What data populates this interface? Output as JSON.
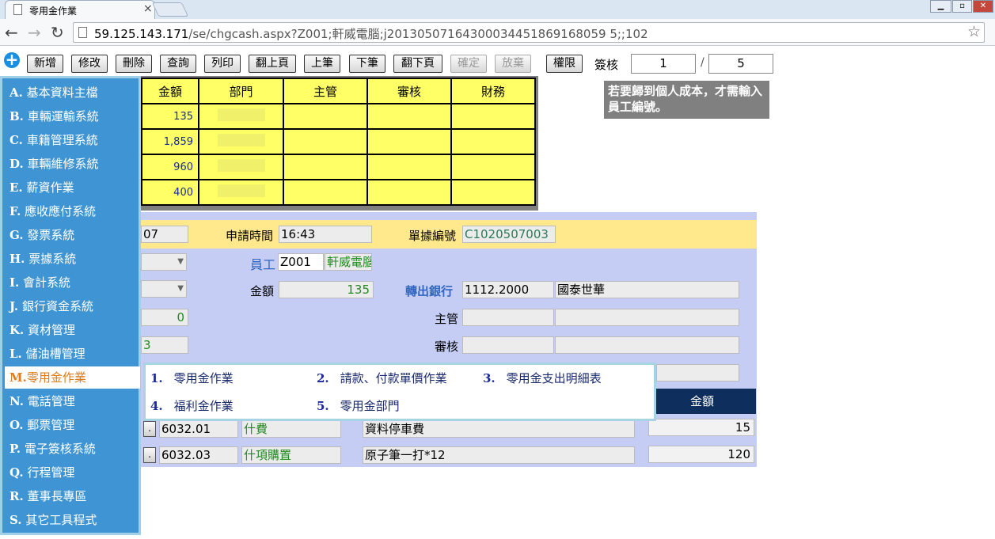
{
  "browser": {
    "tab_title": "零用金作業",
    "url_host": "59.125.143.171",
    "url_path": "/se/chgcash.aspx?Z001;軒威電腦;j20130507164300034451869168059 5;;102"
  },
  "toolbar": {
    "buttons": [
      "新增",
      "修改",
      "刪除",
      "查詢",
      "列印",
      "翻上頁",
      "上筆",
      "下筆",
      "翻下頁",
      "確定",
      "放棄",
      "權限"
    ],
    "sign_label": "簽核",
    "page_current": "1",
    "page_sep": "/",
    "page_total": "5"
  },
  "grid": {
    "headers": [
      "金額",
      "部門",
      "主管",
      "審核",
      "財務"
    ],
    "amounts": [
      "135",
      "1,859",
      "960",
      "400"
    ]
  },
  "tip": "若要歸到個人成本，才需輸入員工編號。",
  "form": {
    "date_tail": "07",
    "apply_time_label": "申請時間",
    "apply_time": "16:43",
    "doc_no_label": "單據編號",
    "doc_no": "C1020507003",
    "employee_label": "員工",
    "employee_id": "Z001",
    "employee_name": "軒威電腦",
    "amount_label": "金額",
    "amount": "135",
    "bank_label": "轉出銀行",
    "bank_code": "1112.2000",
    "bank_name": "國泰世華",
    "left_value": "0",
    "left_value2": "3",
    "manager_label": "主管",
    "review_label": "審核"
  },
  "detail": {
    "amount_header": "金額",
    "rows": [
      {
        "btn": ".",
        "code": "6032.01",
        "cat": "什費",
        "desc": "資料停車費",
        "amount": "15"
      },
      {
        "btn": ".",
        "code": "6032.03",
        "cat": "什項購置",
        "desc": "原子筆一打*12",
        "amount": "120"
      }
    ]
  },
  "menu": [
    {
      "k": "A.",
      "t": "基本資料主檔"
    },
    {
      "k": "B.",
      "t": "車輛運輸系統"
    },
    {
      "k": "C.",
      "t": "車籍管理系統"
    },
    {
      "k": "D.",
      "t": "車輛維修系統"
    },
    {
      "k": "E.",
      "t": "薪資作業"
    },
    {
      "k": "F.",
      "t": "應收應付系統"
    },
    {
      "k": "G.",
      "t": "發票系統"
    },
    {
      "k": "H.",
      "t": "票據系統"
    },
    {
      "k": "I.",
      "t": "會計系統"
    },
    {
      "k": "J.",
      "t": "銀行資金系統"
    },
    {
      "k": "K.",
      "t": "資材管理"
    },
    {
      "k": "L.",
      "t": "儲油槽管理"
    },
    {
      "k": "M.",
      "t": "零用金作業"
    },
    {
      "k": "N.",
      "t": "電話管理"
    },
    {
      "k": "O.",
      "t": "郵票管理"
    },
    {
      "k": "P.",
      "t": "電子簽核系統"
    },
    {
      "k": "Q.",
      "t": "行程管理"
    },
    {
      "k": "R.",
      "t": "董事長專區"
    },
    {
      "k": "S.",
      "t": "其它工具程式"
    }
  ],
  "submenu": [
    {
      "k": "1.",
      "t": "零用金作業"
    },
    {
      "k": "2.",
      "t": "請款、付款單價作業"
    },
    {
      "k": "3.",
      "t": "零用金支出明細表"
    },
    {
      "k": "4.",
      "t": "福利金作業"
    },
    {
      "k": "5.",
      "t": "零用金部門"
    }
  ]
}
